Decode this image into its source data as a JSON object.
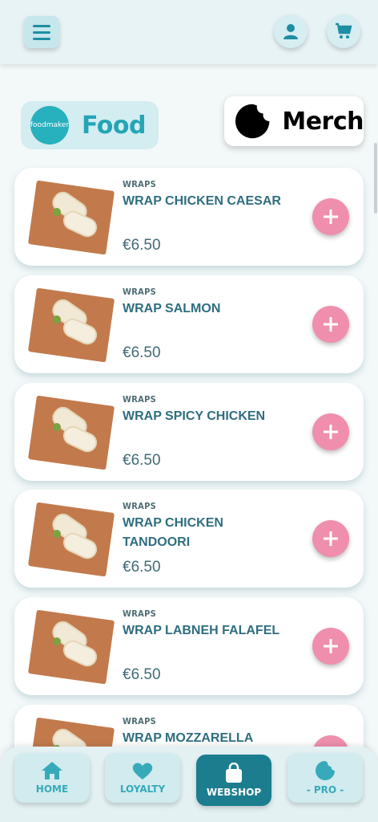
{
  "header": {
    "menu_icon": "hamburger-menu-icon",
    "user_icon": "user-icon",
    "cart_icon": "cart-icon"
  },
  "categories": [
    {
      "label": "Food",
      "logo_text": "foodmaker",
      "active": true
    },
    {
      "label": "Merch",
      "active": false
    }
  ],
  "products": [
    {
      "category": "WRAPS",
      "name": "WRAP CHICKEN CAESAR",
      "price": "€6.50"
    },
    {
      "category": "WRAPS",
      "name": "WRAP SALMON",
      "price": "€6.50"
    },
    {
      "category": "WRAPS",
      "name": "WRAP SPICY CHICKEN",
      "price": "€6.50"
    },
    {
      "category": "WRAPS",
      "name": "WRAP CHICKEN TANDOORI",
      "price": "€6.50"
    },
    {
      "category": "WRAPS",
      "name": "WRAP LABNEH FALAFEL",
      "price": "€6.50"
    },
    {
      "category": "WRAPS",
      "name": "WRAP MOZZARELLA",
      "price": ""
    }
  ],
  "bottom_nav": [
    {
      "label": "HOME",
      "icon": "home-icon",
      "active": false
    },
    {
      "label": "LOYALTY",
      "icon": "heart-icon",
      "active": false
    },
    {
      "label": "WEBSHOP",
      "icon": "shopping-bag-icon",
      "active": true
    },
    {
      "label": "- PRO -",
      "icon": "pro-icon",
      "active": false
    }
  ],
  "colors": {
    "accent": "#1c7d8f",
    "add_button": "#ef8fad",
    "text_primary": "#2f6e80"
  }
}
